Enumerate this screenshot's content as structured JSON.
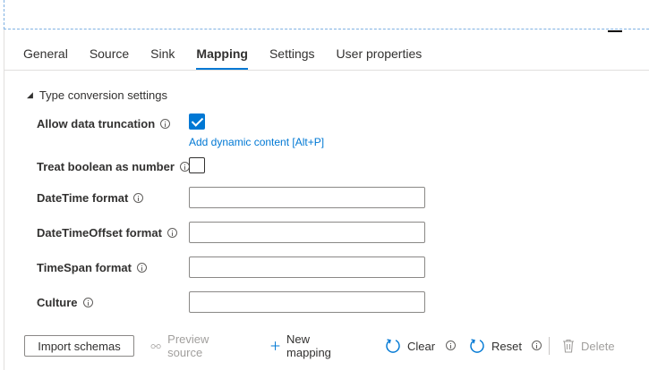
{
  "tabs": [
    {
      "label": "General",
      "active": false
    },
    {
      "label": "Source",
      "active": false
    },
    {
      "label": "Sink",
      "active": false
    },
    {
      "label": "Mapping",
      "active": true
    },
    {
      "label": "Settings",
      "active": false
    },
    {
      "label": "User properties",
      "active": false
    }
  ],
  "section": {
    "title": "Type conversion settings",
    "expanded": true
  },
  "fields": {
    "allow_truncation": {
      "label": "Allow data truncation",
      "checked": true,
      "link": "Add dynamic content [Alt+P]"
    },
    "treat_boolean": {
      "label": "Treat boolean as number",
      "checked": false
    },
    "datetime_format": {
      "label": "DateTime format",
      "value": ""
    },
    "datetimeoffset_format": {
      "label": "DateTimeOffset format",
      "value": ""
    },
    "timespan_format": {
      "label": "TimeSpan format",
      "value": ""
    },
    "culture": {
      "label": "Culture",
      "value": ""
    }
  },
  "toolbar": {
    "import_schemas": "Import schemas",
    "preview_source": "Preview source",
    "new_mapping": "New mapping",
    "clear": "Clear",
    "reset": "Reset",
    "delete": "Delete"
  },
  "colors": {
    "accent": "#0078d4",
    "disabled": "#a19f9d"
  }
}
